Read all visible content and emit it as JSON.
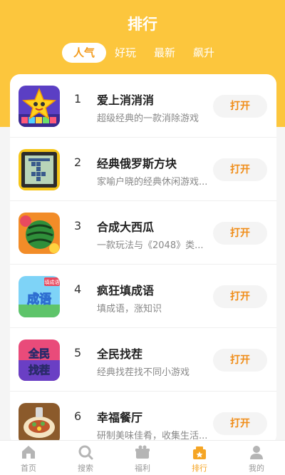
{
  "header": {
    "title": "排行"
  },
  "tabs": [
    {
      "label": "人气",
      "active": true
    },
    {
      "label": "好玩",
      "active": false
    },
    {
      "label": "最新",
      "active": false
    },
    {
      "label": "飙升",
      "active": false
    }
  ],
  "games": [
    {
      "rank": "1",
      "name": "爱上消消消",
      "desc": "超级经典的一款消除游戏",
      "button": "打开",
      "icon": "star-puzzle-icon"
    },
    {
      "rank": "2",
      "name": "经典俄罗斯方块",
      "desc": "家喻户晓的经典休闲游戏...",
      "button": "打开",
      "icon": "tetris-icon"
    },
    {
      "rank": "3",
      "name": "合成大西瓜",
      "desc": "一款玩法与《2048》类...",
      "button": "打开",
      "icon": "watermelon-icon"
    },
    {
      "rank": "4",
      "name": "疯狂填成语",
      "desc": "填成语，涨知识",
      "button": "打开",
      "icon": "idiom-icon"
    },
    {
      "rank": "5",
      "name": "全民找茬",
      "desc": "经典找茬找不同小游戏",
      "button": "打开",
      "icon": "spot-difference-icon"
    },
    {
      "rank": "6",
      "name": "幸福餐厅",
      "desc": "研制美味佳肴，收集生活...",
      "button": "打开",
      "icon": "restaurant-icon"
    }
  ],
  "icon_texts": {
    "idiom": "成语",
    "spot1": "全民",
    "spot2": "找茬",
    "badge": "填成语"
  },
  "nav": [
    {
      "label": "首页",
      "icon": "home-icon",
      "active": false
    },
    {
      "label": "搜索",
      "icon": "search-icon",
      "active": false
    },
    {
      "label": "福利",
      "icon": "gift-icon",
      "active": false
    },
    {
      "label": "排行",
      "icon": "ranking-icon",
      "active": true
    },
    {
      "label": "我的",
      "icon": "profile-icon",
      "active": false
    }
  ],
  "colors": {
    "primary": "#fcc63d",
    "accent": "#f08c16",
    "nav_active": "#f5a524"
  }
}
